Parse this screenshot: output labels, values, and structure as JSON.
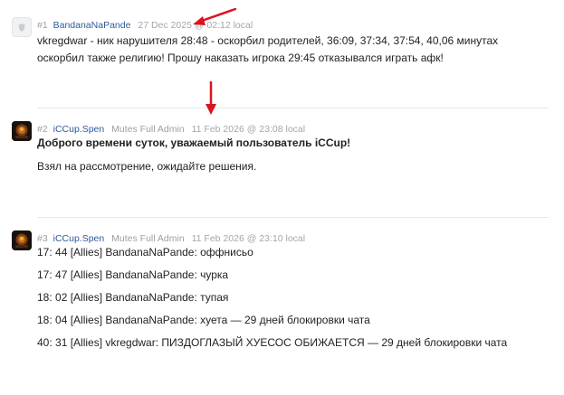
{
  "posts": [
    {
      "number": "#1",
      "username": "BandanaNaPande",
      "role": "",
      "date": "27 Dec 2025 @ 02:12 local",
      "avatar": "default-avatar-icon",
      "lines": [
        "vkregdwar - ник нарушителя 28:48 - оскорбил родителей, 36:09, 37:34, 37:54, 40,06 минутах",
        "оскорбил также религию! Прошу наказать игрока 29:45 отказывался играть афк!"
      ]
    },
    {
      "number": "#2",
      "username": "iCCup.Spen",
      "role": "Mutes Full Admin",
      "date": "11 Feb 2026 @ 23:08 local",
      "avatar": "user-avatar",
      "greeting": "Доброго времени суток, уважаемый пользователь iCCup!",
      "lines": [
        "Взял на рассмотрение, ожидайте решения."
      ]
    },
    {
      "number": "#3",
      "username": "iCCup.Spen",
      "role": "Mutes Full Admin",
      "date": "11 Feb 2026 @ 23:10 local",
      "avatar": "user-avatar",
      "lines": [
        "17: 44 [Allies] BandanaNaPande: оффнисьо",
        "17: 47 [Allies] BandanaNaPande: чурка",
        "18: 02 [Allies] BandanaNaPande: тупая",
        "18: 04 [Allies] BandanaNaPande: хуета — 29 дней блокировки чата",
        "40: 31 [Allies] vkregdwar: ПИЗДОГЛАЗЫЙ ХУЕСОС ОБИЖАЕТСЯ — 29 дней блокировки чата"
      ]
    }
  ],
  "annotation": {
    "arrow_color": "#d9141e"
  }
}
